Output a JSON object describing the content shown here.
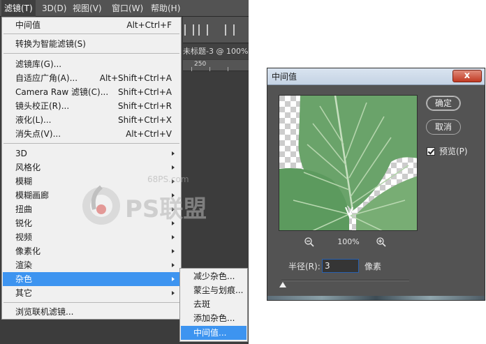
{
  "menubar": {
    "items": [
      "滤镜(T)",
      "3D(D)",
      "视图(V)",
      "窗口(W)",
      "帮助(H)"
    ]
  },
  "document": {
    "tab_label": "未标题-3 @ 100%",
    "ruler_label": "250"
  },
  "filter_menu": {
    "last_filter": {
      "label": "中间值",
      "shortcut": "Alt+Ctrl+F"
    },
    "smart_filters": {
      "label": "转换为智能滤镜(S)"
    },
    "group1": [
      {
        "label": "滤镜库(G)...",
        "shortcut": ""
      },
      {
        "label": "自适应广角(A)...",
        "shortcut": "Alt+Shift+Ctrl+A"
      },
      {
        "label": "Camera Raw 滤镜(C)...",
        "shortcut": "Shift+Ctrl+A"
      },
      {
        "label": "镜头校正(R)...",
        "shortcut": "Shift+Ctrl+R"
      },
      {
        "label": "液化(L)...",
        "shortcut": "Shift+Ctrl+X"
      },
      {
        "label": "消失点(V)...",
        "shortcut": "Alt+Ctrl+V"
      }
    ],
    "group2": [
      {
        "label": "3D"
      },
      {
        "label": "风格化"
      },
      {
        "label": "模糊"
      },
      {
        "label": "模糊画廊"
      },
      {
        "label": "扭曲"
      },
      {
        "label": "锐化"
      },
      {
        "label": "视频"
      },
      {
        "label": "像素化"
      },
      {
        "label": "渲染"
      },
      {
        "label": "杂色"
      },
      {
        "label": "其它"
      }
    ],
    "browse": {
      "label": "浏览联机滤镜..."
    },
    "highlighted_index": 9
  },
  "noise_submenu": {
    "items": [
      "减少杂色...",
      "蒙尘与划痕...",
      "去斑",
      "添加杂色...",
      "中间值..."
    ],
    "highlighted_index": 4
  },
  "watermark": {
    "site": "68PS.com",
    "logo_text": "PS联盟"
  },
  "dialog": {
    "title": "中间值",
    "close_symbol": "x",
    "ok_label": "确定",
    "cancel_label": "取消",
    "preview_label": "预览(P)",
    "preview_checked": true,
    "zoom": "100%",
    "radius_label": "半径(R):",
    "radius_value": "3",
    "radius_unit": "像素",
    "slider_fraction": 0.0
  },
  "icons": {
    "zoom_out": "zoom-out-icon",
    "zoom_in": "zoom-in-icon",
    "submenu_arrow": "chevron-right-icon"
  }
}
